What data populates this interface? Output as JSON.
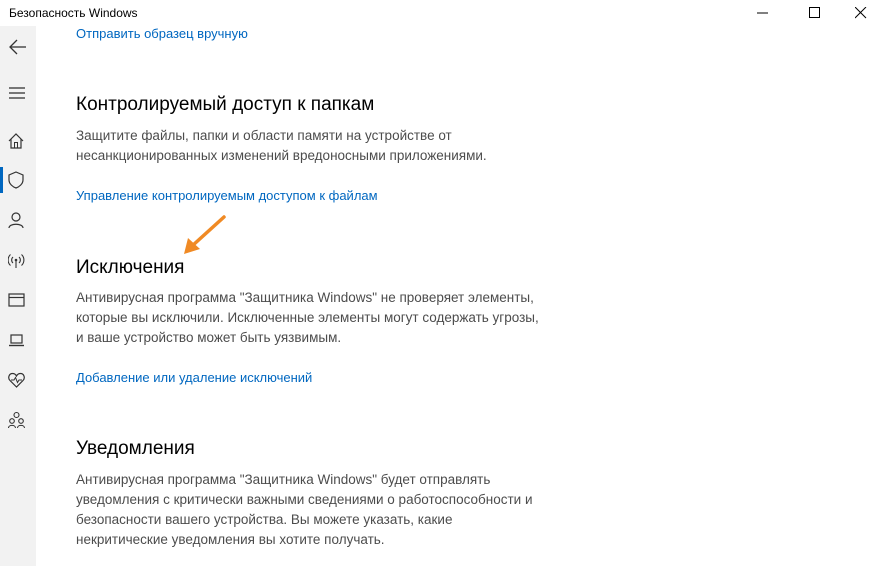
{
  "window": {
    "title": "Безопасность Windows"
  },
  "nav": {
    "items": [
      {
        "icon": "back-icon"
      },
      {
        "icon": "hamburger-icon"
      },
      {
        "icon": "home-icon"
      },
      {
        "icon": "shield-icon",
        "active": true
      },
      {
        "icon": "account-icon"
      },
      {
        "icon": "network-icon"
      },
      {
        "icon": "app-browser-icon"
      },
      {
        "icon": "device-icon"
      },
      {
        "icon": "health-icon"
      },
      {
        "icon": "family-icon"
      }
    ],
    "accent": "#0067c0"
  },
  "content": {
    "top_link": "Отправить образец вручную",
    "sections": [
      {
        "heading": "Контролируемый доступ к папкам",
        "description": "Защитите файлы, папки и области памяти на устройстве от несанкционированных изменений вредоносными приложениями.",
        "link": "Управление контролируемым доступом к файлам"
      },
      {
        "heading": "Исключения",
        "description": "Антивирусная программа \"Защитника Windows\" не проверяет элементы, которые вы исключили. Исключенные элементы могут содержать угрозы, и ваше устройство может быть уязвимым.",
        "link": "Добавление или удаление исключений"
      },
      {
        "heading": "Уведомления",
        "description": "Антивирусная программа \"Защитника Windows\" будет отправлять уведомления с критически важными сведениями о работоспособности и безопасности вашего устройства. Вы можете указать, какие некритические уведомления вы хотите получать."
      }
    ],
    "annotation_arrow_color": "#f08a24",
    "link_color": "#0067c0"
  }
}
